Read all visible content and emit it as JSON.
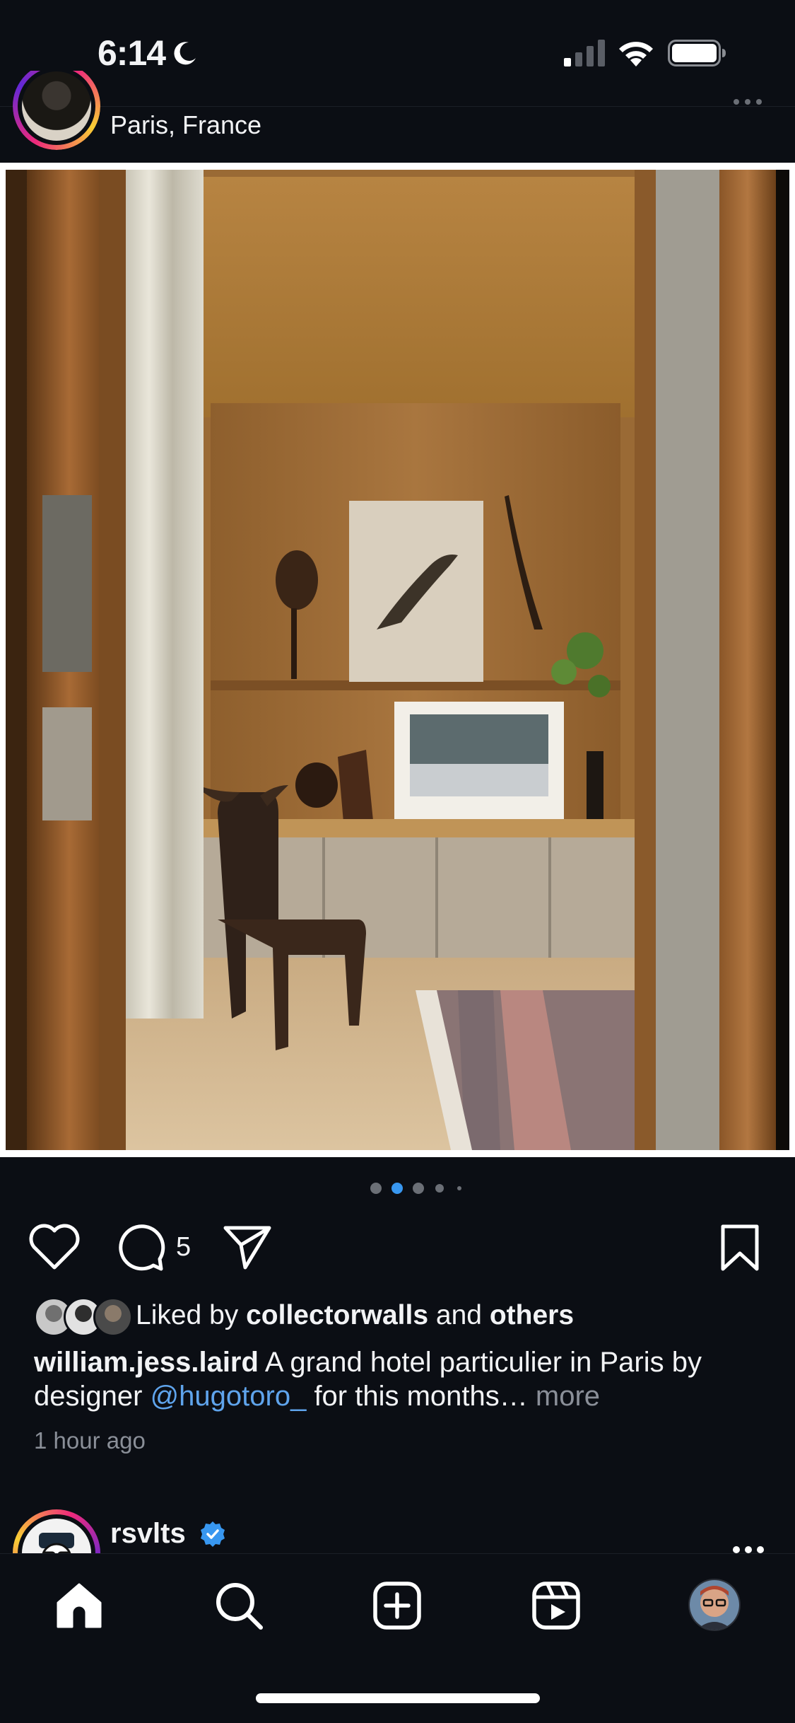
{
  "status_bar": {
    "time": "6:14",
    "icons": [
      "moon-icon",
      "cellular-signal-icon",
      "wifi-icon",
      "battery-icon"
    ]
  },
  "post": {
    "location": "Paris, France",
    "comment_count": "5",
    "carousel": {
      "total": 5,
      "active_index": 1
    },
    "liked_by": {
      "prefix": "Liked by",
      "user": "collectorwalls",
      "joiner": "and",
      "others": "others"
    },
    "caption": {
      "username": "william.jess.laird",
      "text_before_mention": " A grand hotel particulier in Paris by designer ",
      "mention": "@hugotoro_",
      "text_after_mention": " for this months…",
      "more_label": " more"
    },
    "timestamp": "1 hour ago"
  },
  "next_post": {
    "username": "rsvlts",
    "verified": true
  },
  "tab_bar": {
    "items": [
      "home-icon",
      "search-icon",
      "create-icon",
      "reels-icon",
      "profile-avatar"
    ],
    "active": "home"
  },
  "colors": {
    "background": "#0b0e14",
    "text": "#f2f3f5",
    "secondary_text": "#8a8f98",
    "link": "#5fa4ec",
    "active_dot": "#3897f0",
    "verified": "#3897f0"
  }
}
